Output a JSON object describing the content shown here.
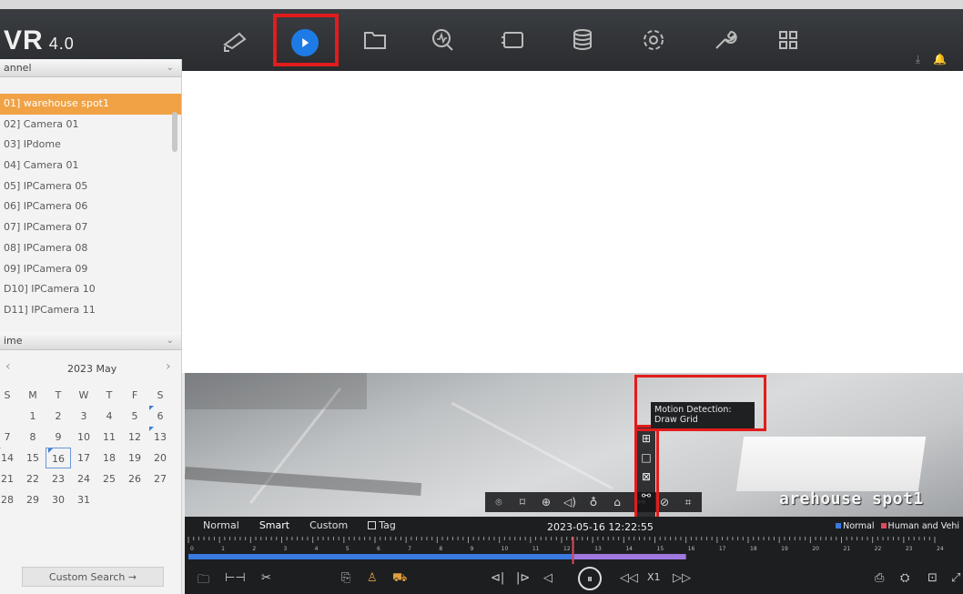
{
  "app": {
    "logo_main": "VR",
    "logo_version": "4.0"
  },
  "nav": {
    "icons": [
      "camera-icon",
      "playback-icon",
      "folder-icon",
      "search-icon",
      "device-icon",
      "storage-icon",
      "settings-icon",
      "maintenance-icon",
      "layout-icon"
    ],
    "active": "playback-icon",
    "accent": "#1e7be6",
    "highlight": "#e21c1c"
  },
  "sidebar": {
    "channel_header": "annel",
    "channels": [
      "01] warehouse spot1",
      "02] Camera 01",
      "03] IPdome",
      "04] Camera 01",
      "05] IPCamera 05",
      "06] IPCamera 06",
      "07] IPCamera 07",
      "08] IPCamera 08",
      "09] IPCamera 09",
      "D10] IPCamera 10",
      "D11] IPCamera 11"
    ],
    "selected_channel": 0,
    "time_header": "ime",
    "calendar": {
      "month_label": "2023 May",
      "weekdays": [
        "S",
        "M",
        "T",
        "W",
        "T",
        "F",
        "S"
      ],
      "days": [
        "",
        "1",
        "2",
        "3",
        "4",
        "5",
        "6",
        "7",
        "8",
        "9",
        "10",
        "11",
        "12",
        "13",
        "14",
        "15",
        "16",
        "17",
        "18",
        "19",
        "20",
        "21",
        "22",
        "23",
        "24",
        "25",
        "26",
        "27",
        "28",
        "29",
        "30",
        "31",
        "",
        "",
        ""
      ],
      "selected_day": "16"
    },
    "custom_search_label": "Custom Search →"
  },
  "video": {
    "osd_name": "arehouse spot1",
    "tooltip": "Motion Detection: Draw Grid"
  },
  "timeline": {
    "modes": [
      "Normal",
      "Smart",
      "Custom"
    ],
    "active_mode": "Smart",
    "tag_label": "Tag",
    "timestamp": "2023-05-16 12:22:55",
    "legend_normal": "Normal",
    "legend_human": "Human and Vehi",
    "legend_colors": {
      "normal": "#3a79e0",
      "human": "#e04a5a"
    },
    "hours": [
      "0",
      "1",
      "2",
      "3",
      "4",
      "5",
      "6",
      "7",
      "8",
      "9",
      "10",
      "11",
      "12",
      "13",
      "14",
      "15",
      "16",
      "17",
      "18",
      "19",
      "20",
      "21",
      "22",
      "23",
      "24"
    ],
    "speed_label": "X1"
  }
}
